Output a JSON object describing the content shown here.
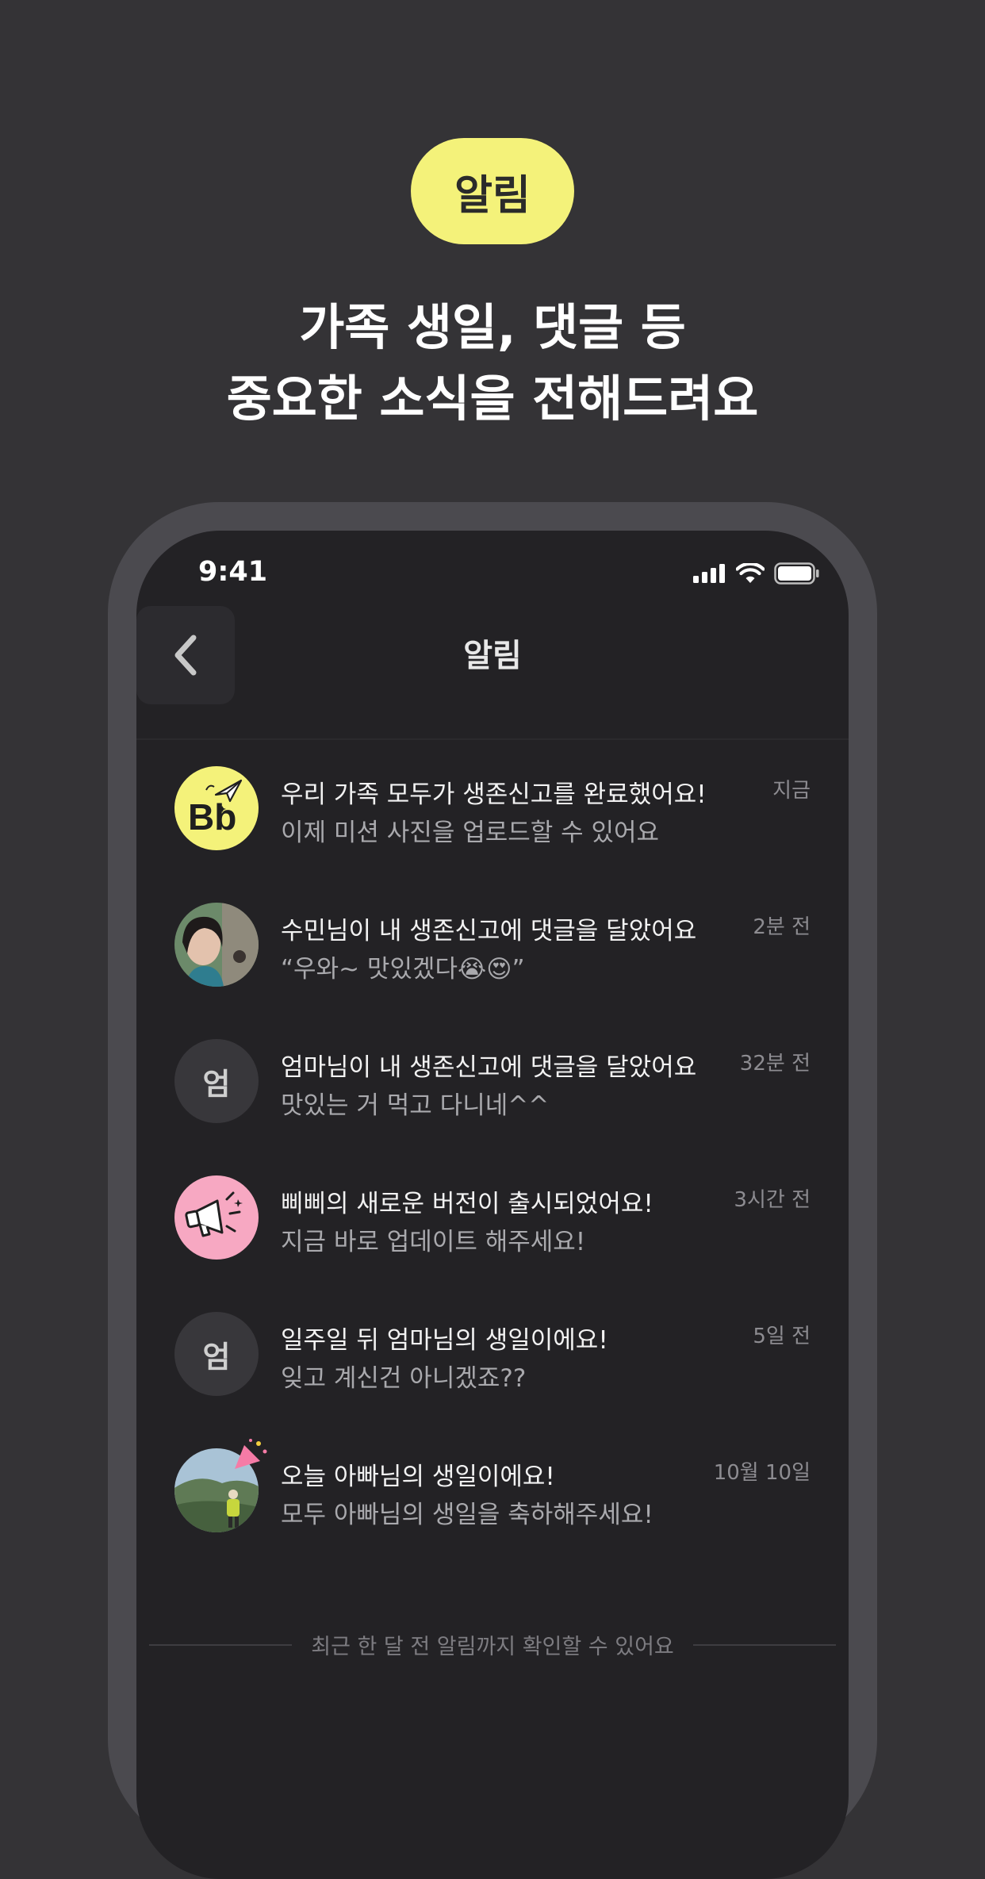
{
  "promo": {
    "badge": "알림",
    "headline_line1": "가족 생일, 댓글 등",
    "headline_line2": "중요한 소식을 전해드려요",
    "badge_color": "#F4F27A",
    "background_color": "#343336"
  },
  "status_bar": {
    "time": "9:41"
  },
  "nav": {
    "title": "알림"
  },
  "notifications": [
    {
      "avatar_type": "app-logo",
      "title": "우리 가족 모두가 생존신고를 완료했어요!",
      "body": "이제 미션 사진을 업로드할 수 있어요",
      "time": "지금"
    },
    {
      "avatar_type": "user-photo",
      "title": "수민님이  내 생존신고에 댓글을 달았어요",
      "body": "“우와~ 맛있겠다😭😍”",
      "time": "2분 전"
    },
    {
      "avatar_type": "initial",
      "avatar_text": "엄",
      "title": "엄마님이  내 생존신고에 댓글을 달았어요",
      "body": "맛있는 거 먹고 다니네^^",
      "time": "32분 전"
    },
    {
      "avatar_type": "megaphone",
      "title": "삐삐의 새로운 버전이 출시되었어요!",
      "body": "지금 바로 업데이트 해주세요!",
      "time": "3시간 전"
    },
    {
      "avatar_type": "initial",
      "avatar_text": "엄",
      "title": "일주일 뒤 엄마님의 생일이에요!",
      "body": "잊고 계신건 아니겠죠??",
      "time": "5일 전"
    },
    {
      "avatar_type": "user-photo-party",
      "title": "오늘 아빠님의 생일이에요!",
      "body": "모두 아빠님의 생일을 축하해주세요!",
      "time": "10월 10일"
    }
  ],
  "footer": {
    "note": "최근 한 달 전 알림까지 확인할 수 있어요"
  }
}
